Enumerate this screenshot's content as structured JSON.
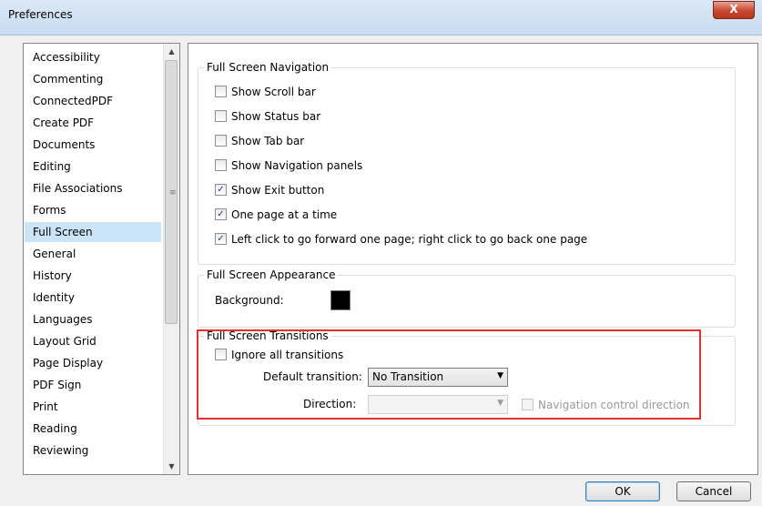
{
  "window": {
    "title": "Preferences",
    "close_glyph": "X"
  },
  "sidebar": {
    "items": [
      {
        "label": "Accessibility"
      },
      {
        "label": "Commenting"
      },
      {
        "label": "ConnectedPDF"
      },
      {
        "label": "Create PDF"
      },
      {
        "label": "Documents"
      },
      {
        "label": "Editing"
      },
      {
        "label": "File Associations"
      },
      {
        "label": "Forms"
      },
      {
        "label": "Full Screen",
        "selected": true
      },
      {
        "label": "General"
      },
      {
        "label": "History"
      },
      {
        "label": "Identity"
      },
      {
        "label": "Languages"
      },
      {
        "label": "Layout Grid"
      },
      {
        "label": "Page Display"
      },
      {
        "label": "PDF Sign"
      },
      {
        "label": "Print"
      },
      {
        "label": "Reading"
      },
      {
        "label": "Reviewing"
      }
    ],
    "scroll_up_glyph": "▲",
    "scroll_down_glyph": "▼",
    "grip_glyph": "≡"
  },
  "navigation": {
    "legend": "Full Screen Navigation",
    "options": [
      {
        "label": "Show Scroll bar",
        "checked": false
      },
      {
        "label": "Show Status bar",
        "checked": false
      },
      {
        "label": "Show Tab bar",
        "checked": false
      },
      {
        "label": "Show Navigation panels",
        "checked": false
      },
      {
        "label": "Show Exit button",
        "checked": true
      },
      {
        "label": "One page at a time",
        "checked": true
      },
      {
        "label": "Left click to go forward one page; right click to go back one page",
        "checked": true
      }
    ]
  },
  "appearance": {
    "legend": "Full Screen Appearance",
    "background_label": "Background:",
    "background_color": "#000000"
  },
  "transitions": {
    "legend": "Full Screen Transitions",
    "ignore_label": "Ignore all transitions",
    "ignore_checked": false,
    "default_transition_label": "Default transition:",
    "default_transition_value": "No Transition",
    "direction_label": "Direction:",
    "direction_value": "",
    "nav_control_label": "Navigation control direction",
    "nav_control_checked": false
  },
  "glyphs": {
    "check": "✓",
    "dropdown": "▼"
  },
  "buttons": {
    "ok": "OK",
    "cancel": "Cancel"
  },
  "colors": {
    "highlight": "#e63030",
    "selection": "#cce4f7"
  }
}
